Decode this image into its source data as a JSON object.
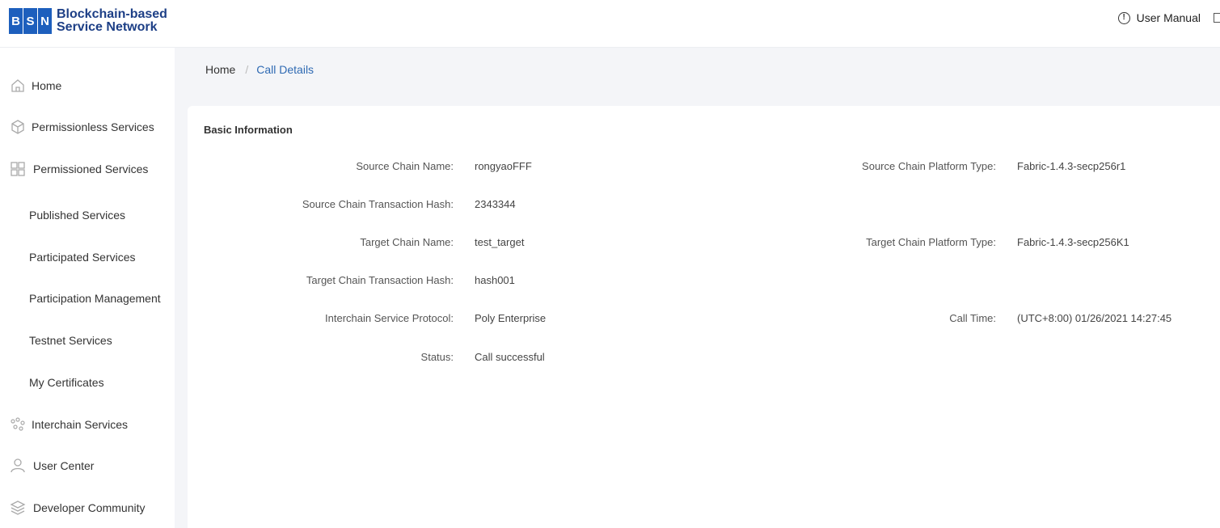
{
  "header": {
    "logo_letters": [
      "B",
      "S",
      "N"
    ],
    "logo_line1": "Blockchain-based",
    "logo_line2": "Service Network",
    "user_manual": "User Manual"
  },
  "sidebar": {
    "items": [
      {
        "label": "Home",
        "icon": "home-icon"
      },
      {
        "label": "Permissionless Services",
        "icon": "cube-icon"
      },
      {
        "label": "Permissioned Services",
        "icon": "grid-icon"
      },
      {
        "label": "Published Services"
      },
      {
        "label": "Participated Services"
      },
      {
        "label": "Participation Management"
      },
      {
        "label": "Testnet Services"
      },
      {
        "label": "My Certificates"
      },
      {
        "label": "Interchain Services",
        "icon": "interchain-icon"
      },
      {
        "label": "User Center",
        "icon": "user-icon"
      },
      {
        "label": "Developer Community",
        "icon": "layers-icon"
      }
    ]
  },
  "breadcrumb": {
    "home": "Home",
    "separator": "/",
    "current": "Call Details"
  },
  "card": {
    "title": "Basic Information",
    "left_fields": [
      {
        "label": "Source Chain Name:",
        "value": "rongyaoFFF"
      },
      {
        "label": "Source Chain Transaction Hash:",
        "value": "2343344"
      },
      {
        "label": "Target Chain Name:",
        "value": "test_target"
      },
      {
        "label": "Target Chain Transaction Hash:",
        "value": "hash001"
      },
      {
        "label": "Interchain Service Protocol:",
        "value": "Poly Enterprise"
      },
      {
        "label": "Status:",
        "value": "Call successful"
      }
    ],
    "right_fields": [
      {
        "label": "Source Chain Platform Type:",
        "value": "Fabric-1.4.3-secp256r1"
      },
      {
        "label": "Target Chain Platform Type:",
        "value": "Fabric-1.4.3-secp256K1"
      },
      {
        "label": "Call Time:",
        "value": "(UTC+8:00) 01/26/2021 14:27:45"
      }
    ]
  },
  "colors": {
    "brand": "#1d5fbd",
    "brand_text": "#1d3f86",
    "link": "#2f6ab3",
    "main_bg": "#f4f5f8"
  }
}
